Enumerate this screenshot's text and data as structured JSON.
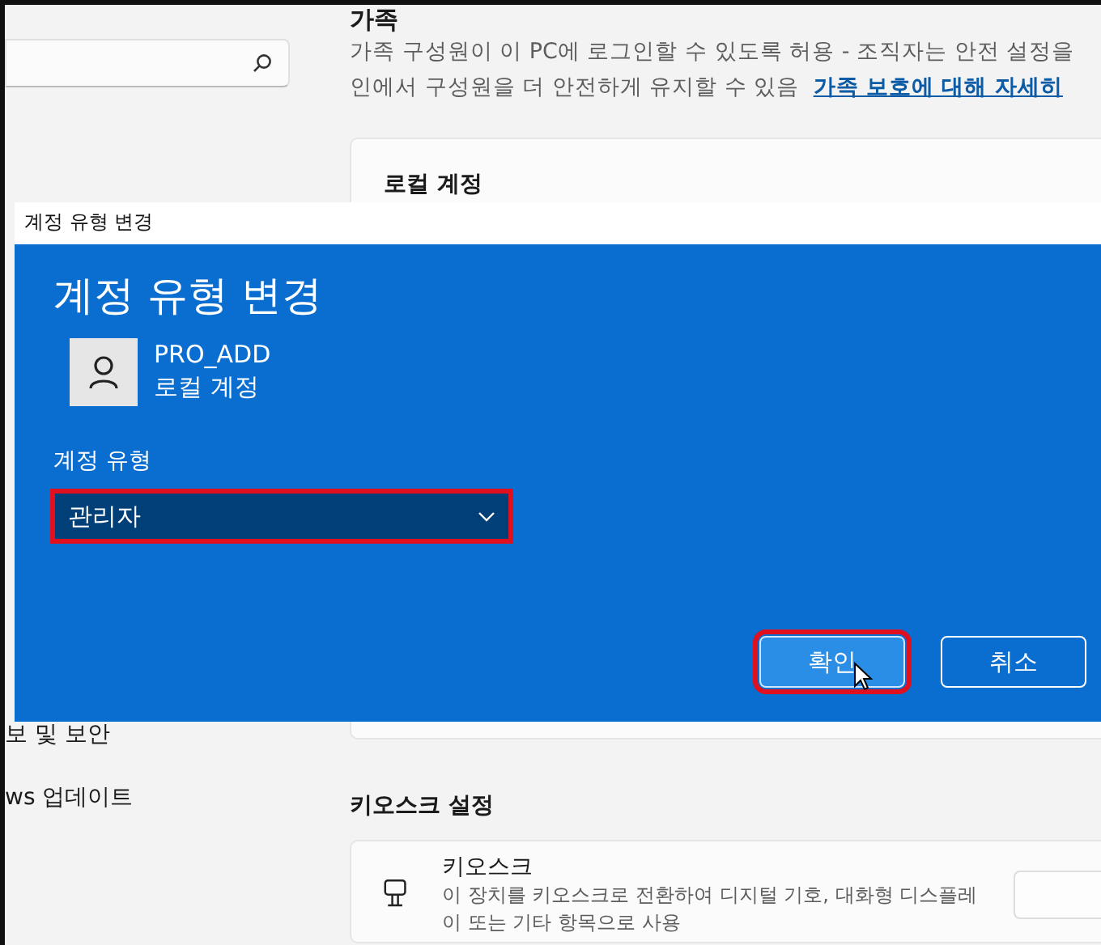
{
  "sidebar": {
    "items": [
      {
        "label": "보 및 보안"
      },
      {
        "label": "ws 업데이트"
      }
    ]
  },
  "family": {
    "heading": "가족",
    "description": "가족 구성원이 이 PC에 로그인할 수 있도록 허용 - 조직자는 안전 설정을",
    "description_2": "인에서 구성원을 더 안전하게 유지할 수 있음",
    "link": "가족 보호에 대해 자세히"
  },
  "local_account_card": {
    "title": "로컬 계정"
  },
  "dialog": {
    "window_title": "계정 유형 변경",
    "heading": "계정 유형 변경",
    "user": {
      "name": "PRO_ADD",
      "type": "로컬 계정"
    },
    "field_label": "계정 유형",
    "select": {
      "value": "관리자",
      "highlighted": true
    },
    "buttons": [
      {
        "label": "확인",
        "kind": "primary",
        "highlighted": true
      },
      {
        "label": "취소",
        "kind": "secondary",
        "highlighted": false
      }
    ]
  },
  "kiosk": {
    "heading": "키오스크 설정",
    "title": "키오스크",
    "description": "이 장치를 키오스크로 전환하여 디지털 기호, 대화형 디스플레",
    "description_2": "이 또는 기타 항목으로 사용"
  }
}
